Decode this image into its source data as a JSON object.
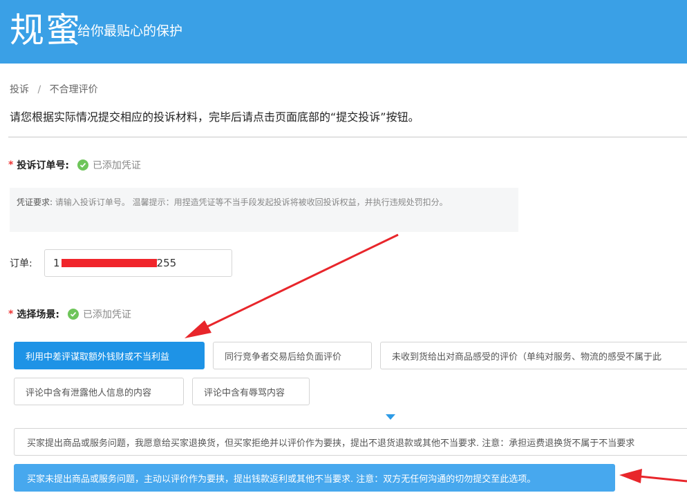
{
  "header": {
    "brand": "规蜜",
    "slogan": "给你最贴心的保护",
    "background_color": "#3aa0e6"
  },
  "breadcrumb": {
    "items": [
      "投诉",
      "不合理评价"
    ],
    "separator": "/"
  },
  "intro": "请您根据实际情况提交相应的投诉材料，完毕后请点击页面底部的“提交投诉”按钮。",
  "order_section": {
    "label": "投诉订单号:",
    "status": "已添加凭证",
    "notice_label": "凭证要求:",
    "notice_text": " 请输入投诉订单号。 温馨提示：用捏造凭证等不当手段发起投诉将被收回投诉权益，并执行违规处罚扣分。",
    "input_label": "订单:",
    "input_value_head": "1",
    "input_value_tail": "255"
  },
  "scene_section": {
    "label": "选择场景:",
    "status": "已添加凭证",
    "options_row1": [
      "利用中差评谋取额外钱财或不当利益",
      "同行竞争者交易后给负面评价",
      "未收到货给出对商品感受的评价（单纯对服务、物流的感受不属于此"
    ],
    "options_row2": [
      "评论中含有泄露他人信息的内容",
      "评论中含有辱骂内容"
    ],
    "sub_options": [
      "买家提出商品或服务问题，我愿意给买家退换货，但买家拒绝并以评价作为要挟，提出不退货退款或其他不当要求. 注意：承担运费退换货不属于不当要求",
      "买家未提出商品或服务问题，主动以评价作为要挟，提出钱款返利或其他不当要求. 注意：双方无任何沟通的切勿提交至此选项。"
    ],
    "selected_color": "#1e93e6"
  },
  "annotation_color": "#e8262b"
}
